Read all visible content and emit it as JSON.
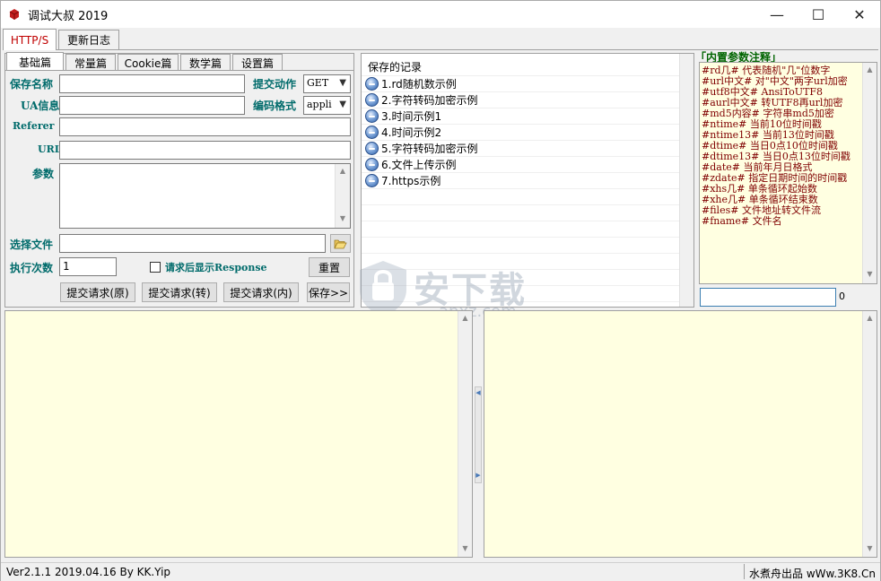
{
  "window": {
    "title": "调试大叔 2019",
    "controls": {
      "minimize": "—",
      "maximize": "☐",
      "close": "✕"
    }
  },
  "top_tabs": [
    {
      "label": "HTTP/S",
      "active": true
    },
    {
      "label": "更新日志",
      "active": false
    }
  ],
  "sub_tabs": [
    {
      "label": "基础篇",
      "active": true
    },
    {
      "label": "常量篇",
      "active": false
    },
    {
      "label": "Cookie篇",
      "active": false
    },
    {
      "label": "数学篇",
      "active": false
    },
    {
      "label": "设置篇",
      "active": false
    }
  ],
  "form": {
    "save_name_label": "保存名称",
    "save_name_value": "",
    "submit_action_label": "提交动作",
    "submit_action_value": "GET",
    "ua_label": "UA信息",
    "ua_value": "",
    "encoding_label": "编码格式",
    "encoding_value": "appli",
    "referer_label": "Referer",
    "referer_value": "",
    "url_label": "URL",
    "url_value": "",
    "params_label": "参数",
    "params_value": "",
    "select_file_label": "选择文件",
    "select_file_value": "",
    "exec_count_label": "执行次数",
    "exec_count_value": "1",
    "show_response_label": "请求后显示Response",
    "show_response_checked": false,
    "reset_button": "重置",
    "submit_raw_button": "提交请求(原)",
    "submit_convert_button": "提交请求(转)",
    "submit_inner_button": "提交请求(内)",
    "save_button": "保存>>"
  },
  "records": {
    "header": "保存的记录",
    "items": [
      "1.rd随机数示例",
      "2.字符转码加密示例",
      "3.时间示例1",
      "4.时间示例2",
      "5.字符转码加密示例",
      "6.文件上传示例",
      "7.https示例"
    ]
  },
  "builtin_params": {
    "title": "「内置参数注释」",
    "lines": [
      "#rd几#   代表随机\"几\"位数字",
      "#url中文#  对\"中文\"两字url加密",
      "#utf8中文#  AnsiToUTF8",
      "#aurl中文#  转UTF8再url加密",
      "#md5内容#    字符串md5加密",
      "#ntime#      当前10位时间戳",
      "#ntime13#    当前13位时间戳",
      "#dtime#    当日0点10位时间戳",
      "#dtime13#  当日0点13位时间戳",
      "#date#   当前年月日格式",
      "#zdate#  指定日期时间的时间戳",
      "#xhs几#  单条循环起始数",
      "#xhe几#  单条循环结束数",
      "#files#  文件地址转文件流",
      "#fname#  文件名"
    ],
    "input_value": "",
    "count": "0"
  },
  "watermark": {
    "brand": "安下载",
    "site": "anxz.com"
  },
  "status_bar": {
    "left": "Ver2.1.1 2019.04.16 By KK.Yip",
    "right": "水煮舟出品 wWw.3K8.Cn"
  },
  "colors": {
    "label_teal": "#006b6b",
    "param_text": "#800000",
    "active_tab_text": "#c00000",
    "output_bg": "#ffffe1"
  }
}
